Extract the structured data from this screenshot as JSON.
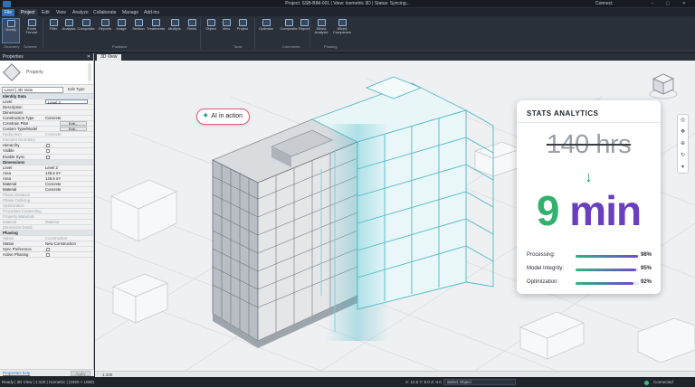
{
  "titlebar": {
    "title": "Project: SSB-BIM-001 | View: Isometric 3D | Status: Syncing...",
    "user": "Connect",
    "window_controls": "– ▢ ✕"
  },
  "menu": {
    "tabs": [
      "File",
      "Project",
      "Edit",
      "View",
      "Analyze",
      "Collaborate",
      "Manage",
      "Add-ins"
    ]
  },
  "ribbon": {
    "buttons": [
      "Modify",
      "Roots Format",
      "Filter",
      "Analysis",
      "Composite",
      "Reports",
      "Image",
      "Section",
      "Treatments",
      "Multiple",
      "Fields",
      "Object",
      "View",
      "Project",
      "Optimize",
      "Composite",
      "Report",
      "Show Calculation",
      "Mixed Analysis",
      "Mixed Complexes"
    ],
    "groups": [
      "Geometry",
      "Scheme",
      "Positions",
      "Tools",
      "Comments",
      "Phasing"
    ]
  },
  "properties": {
    "header": "Properties",
    "family": "Property",
    "selector": "Level | 3D View",
    "edit_type": "Edit Type",
    "rows": [
      {
        "k": "Identity Data",
        "v": "",
        "type": "grp"
      },
      {
        "k": "Level",
        "v": "Level 2",
        "type": "input"
      },
      {
        "k": "Description",
        "v": "",
        "type": "row"
      },
      {
        "k": "Dimensions",
        "v": "",
        "type": "row"
      },
      {
        "k": "Construction Type",
        "v": "Concrete",
        "type": "row"
      },
      {
        "k": "Constrain Plan",
        "v": "Edit...",
        "type": "btn"
      },
      {
        "k": "Custom Type/Model",
        "v": "Edit...",
        "type": "btn"
      },
      {
        "k": "Radio Item",
        "v": "Concrete",
        "type": "dim"
      },
      {
        "k": "Element Geometry",
        "v": "",
        "type": "dim"
      },
      {
        "k": "Hierarchy",
        "v": "",
        "type": "chk"
      },
      {
        "k": "Visible",
        "v": "",
        "type": "chk"
      },
      {
        "k": "Enable Sync",
        "v": "",
        "type": "chk"
      },
      {
        "k": "Dimensions",
        "v": "",
        "type": "grp"
      },
      {
        "k": "Level",
        "v": "Level 2",
        "type": "row"
      },
      {
        "k": "Area",
        "v": "145.6 m²",
        "type": "row"
      },
      {
        "k": "Area",
        "v": "145.6 m²",
        "type": "row"
      },
      {
        "k": "Material",
        "v": "Concrete",
        "type": "row"
      },
      {
        "k": "Material",
        "v": "Concrete",
        "type": "row"
      },
      {
        "k": "Phase Distance",
        "v": "",
        "type": "dim"
      },
      {
        "k": "Phase Ordering",
        "v": "",
        "type": "dim"
      },
      {
        "k": "Optimization",
        "v": "",
        "type": "dim"
      },
      {
        "k": "Procedure Connecting",
        "v": "",
        "type": "dim"
      },
      {
        "k": "Property Materials",
        "v": "",
        "type": "dim"
      },
      {
        "k": "Material",
        "v": "Material",
        "type": "dim"
      },
      {
        "k": "Dimension Detail",
        "v": "",
        "type": "dim"
      },
      {
        "k": "Phasing",
        "v": "",
        "type": "grp"
      },
      {
        "k": "Status",
        "v": "Construction",
        "type": "dim"
      },
      {
        "k": "Status",
        "v": "New Construction",
        "type": "row"
      },
      {
        "k": "Sync Preference",
        "v": "",
        "type": "chk"
      },
      {
        "k": "Active Phasing",
        "v": "",
        "type": "chk"
      }
    ],
    "help_link": "Properties help",
    "apply": "Apply"
  },
  "view": {
    "tab": "3D View",
    "scale": "1:100",
    "ai_pill": "AI in action",
    "spark_icon": "✦"
  },
  "stats": {
    "title": "STATS ANALYTICS",
    "before": "140 hrs",
    "arrow": "↓",
    "after_num": "9",
    "after_unit": "min",
    "rows": [
      {
        "label": "Processing:",
        "value": "98%",
        "pct": 98
      },
      {
        "label": "Model Integrity:",
        "value": "95%",
        "pct": 95
      },
      {
        "label": "Optimization:",
        "value": "92%",
        "pct": 92
      }
    ],
    "accent_green": "#34b06e",
    "accent_purple": "#6a3fbf"
  },
  "status": {
    "left": "Ready | 3D View | 1:100 | Isometric | (1920 × 1080)",
    "coords": "X: 12.5  Y: 8.0  Z: 0.0",
    "select": "Select Object",
    "connection": "Connected"
  }
}
